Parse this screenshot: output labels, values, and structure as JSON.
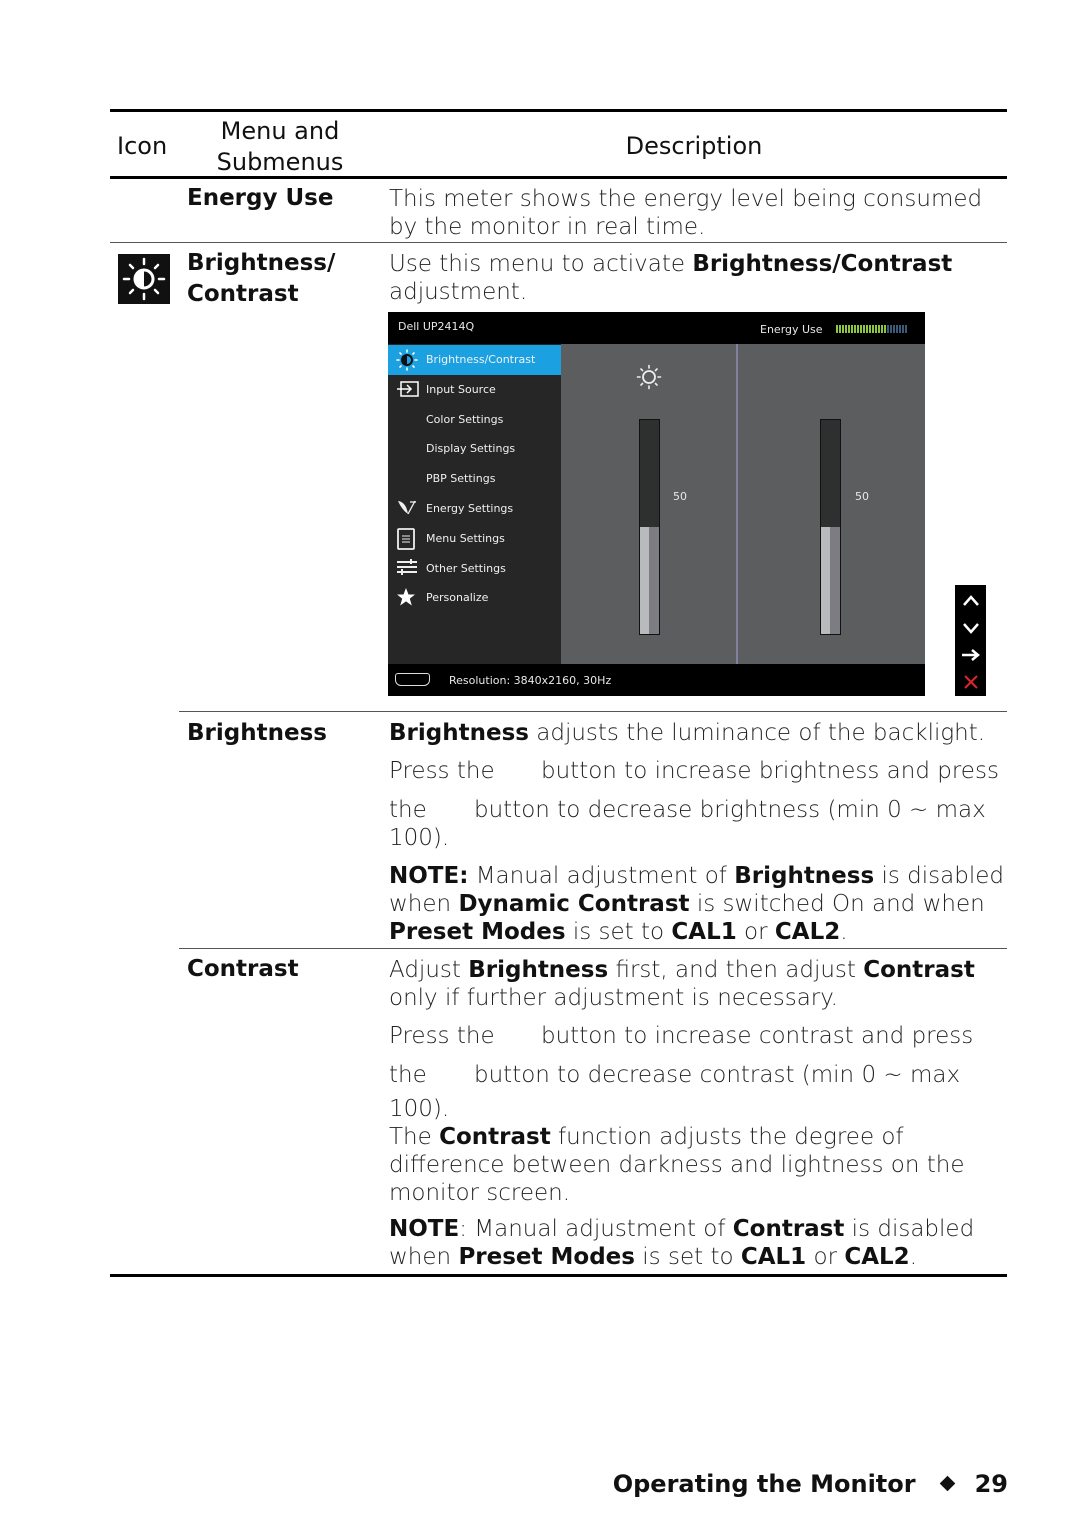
{
  "table": {
    "headers": {
      "icon": "Icon",
      "menu_line1": "Menu and",
      "menu_line2": "Submenus",
      "description": "Description"
    },
    "rows": [
      {
        "menu": "Energy Use",
        "description": [
          "This meter shows the energy level being consumed",
          "by the monitor in real time."
        ]
      },
      {
        "icon": "brightness-contrast-icon",
        "menu_line1": "Brightness/",
        "menu_line2": "Contrast",
        "description_pre": "Use this menu to activate ",
        "description_bold": "Brightness/Contrast",
        "description_line2": "adjustment."
      },
      {
        "menu": "Brightness",
        "p1_bold": "Brightness",
        "p1_rest": " adjusts the luminance of the backlight.",
        "p2_pre": "Press the",
        "p2_post": "button to increase brightness and press",
        "p3_pre": "the",
        "p3_post": "button to decrease brightness (min 0 ~ max",
        "p3_line2": "100).",
        "note_label": "NOTE:",
        "note_1": " Manual adjustment of ",
        "note_b1": "Brightness",
        "note_2": " is disabled",
        "note_3": "when ",
        "note_b2": "Dynamic Contrast",
        "note_4": " is switched On and when",
        "note_b3": "Preset Modes",
        "note_5": " is set to ",
        "note_b4": "CAL1",
        "note_6": " or ",
        "note_b5": "CAL2",
        "note_7": "."
      },
      {
        "menu": "Contrast",
        "p1_a": "Adjust ",
        "p1_b1": "Brightness",
        "p1_c": " first, and then adjust ",
        "p1_b2": "Contrast",
        "p1_line2": "only if further adjustment is necessary.",
        "p2_pre": "Press the",
        "p2_post": "button to increase contrast and press",
        "p3_pre": "the",
        "p3_post": "button to decrease contrast (min 0 ~ max",
        "p3_line2": "100).",
        "p4_a": "The ",
        "p4_b": "Contrast",
        "p4_c": " function adjusts the degree of",
        "p4_line2": "difference between darkness and lightness on the",
        "p4_line3": "monitor screen.",
        "note_label": "NOTE",
        "note_1": ": Manual adjustment of ",
        "note_b1": "Contrast",
        "note_2": " is disabled",
        "note_3": "when ",
        "note_b2": "Preset Modes",
        "note_4": " is set to ",
        "note_b3": "CAL1",
        "note_5": " or ",
        "note_b4": "CAL2",
        "note_6": "."
      }
    ]
  },
  "osd": {
    "model": "Dell UP2414Q",
    "energy_label": "Energy Use",
    "energy_meter": {
      "segments_total": 24,
      "segments_lit": 17,
      "lit_color": "#8dc63f",
      "unlit_color": "#3a5a7a"
    },
    "menu_items": [
      {
        "label": "Brightness/Contrast",
        "icon": "brightness-contrast-icon",
        "active": true
      },
      {
        "label": "Input Source",
        "icon": "input-source-icon",
        "active": false
      },
      {
        "label": "Color Settings",
        "icon": "",
        "active": false
      },
      {
        "label": "Display Settings",
        "icon": "",
        "active": false
      },
      {
        "label": "PBP Settings",
        "icon": "",
        "active": false
      },
      {
        "label": "Energy Settings",
        "icon": "energy-leaf-icon",
        "active": false
      },
      {
        "label": "Menu Settings",
        "icon": "menu-settings-icon",
        "active": false
      },
      {
        "label": "Other Settings",
        "icon": "other-settings-icon",
        "active": false
      },
      {
        "label": "Personalize",
        "icon": "star-icon",
        "active": false
      }
    ],
    "brightness_value": "50",
    "brightness_level": 0.5,
    "contrast_value": "50",
    "contrast_level": 0.5,
    "resolution": "Resolution: 3840x2160, 30Hz",
    "accent_color": "#1ba1e2",
    "nav_buttons": [
      "up-arrow-icon",
      "down-arrow-icon",
      "right-arrow-icon",
      "close-x-icon"
    ]
  },
  "footer": {
    "section": "Operating the Monitor",
    "page_number": "29"
  }
}
